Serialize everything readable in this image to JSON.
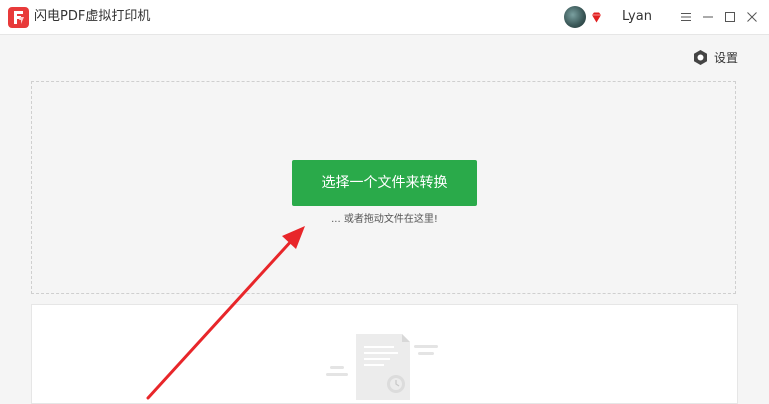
{
  "window": {
    "title": "闪电PDF虚拟打印机",
    "username": "Lyan"
  },
  "icons": {
    "logo": "app-logo-icon",
    "avatar": "user-avatar",
    "vip": "vip-diamond-icon",
    "menu": "menu-icon",
    "minimize": "minimize-icon",
    "maximize": "maximize-icon",
    "close": "close-icon",
    "settings": "hexagon-gear-icon",
    "empty": "empty-document-icon",
    "annotation": "red-arrow"
  },
  "toolbar": {
    "settings_label": "设置"
  },
  "drop_zone": {
    "button_label": "选择一个文件来转换",
    "hint": "... 或者拖动文件在这里!"
  },
  "colors": {
    "accent_green": "#2aaa4a",
    "logo_red": "#e83a3a",
    "arrow_red": "#e8262a",
    "vip_red": "#e02020"
  }
}
